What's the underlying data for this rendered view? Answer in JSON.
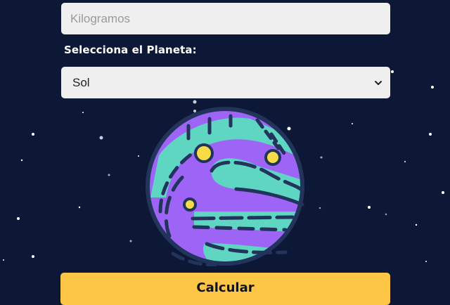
{
  "form": {
    "weight_placeholder": "Kilogramos",
    "weight_value": "",
    "planet_label": "Selecciona el Planeta:",
    "planet_selected": "Sol",
    "submit_label": "Calcular"
  },
  "illustration": {
    "icon": "purple-planet-icon"
  },
  "colors": {
    "background": "#0c1836",
    "input_bg": "#efefef",
    "button": "#fec647",
    "planet_body": "#9d64f6",
    "planet_stripes": "#5ed6c2",
    "planet_craters": "#f7dc47",
    "planet_outline": "#22345c"
  }
}
